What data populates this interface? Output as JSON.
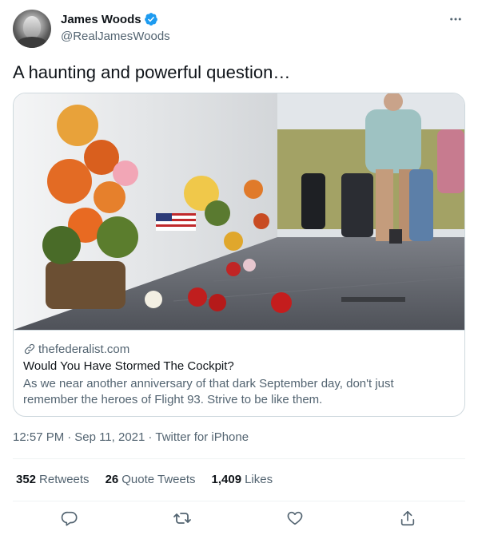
{
  "author": {
    "display_name": "James Woods",
    "handle": "@RealJamesWoods",
    "verified": true
  },
  "tweet": {
    "text": "A haunting and powerful question…"
  },
  "card": {
    "domain": "thefederalist.com",
    "title": "Would You Have Stormed The Cockpit?",
    "description_line1": "As we near another anniversary of that dark September day, don't just",
    "description_line2": "remember the heroes of Flight 93. Strive to be like them."
  },
  "meta": {
    "time": "12:57 PM",
    "sep1": "·",
    "date": "Sep 11, 2021",
    "sep2": "·",
    "source": "Twitter for iPhone"
  },
  "stats": {
    "retweets_count": "352",
    "retweets_label": "Retweets",
    "quotes_count": "26",
    "quotes_label": "Quote Tweets",
    "likes_count": "1,409",
    "likes_label": "Likes"
  },
  "colors": {
    "accent": "#1d9bf0",
    "text_primary": "#0f1419",
    "text_secondary": "#536471",
    "border": "#cfd9de"
  },
  "icons": [
    "verified-badge-icon",
    "more-icon",
    "link-icon",
    "reply-icon",
    "retweet-icon",
    "like-icon",
    "share-icon"
  ]
}
